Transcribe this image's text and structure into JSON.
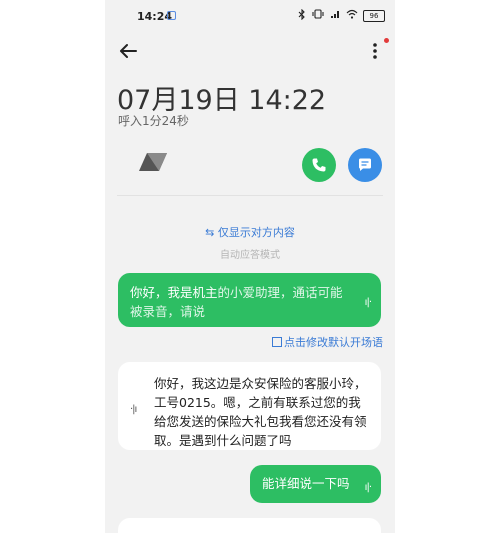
{
  "status_bar": {
    "time": "14:24",
    "battery": "96",
    "icons": [
      "bluetooth-icon",
      "vibrate-icon",
      "signal-icon",
      "wifi-icon",
      "battery-icon"
    ]
  },
  "header": {
    "title": "07月19日 14:22",
    "subtitle": "呼入1分24秒"
  },
  "links": {
    "show_other_party": "仅显示对方内容",
    "auto_answer_mode": "自动应答模式",
    "edit_greeting": "点击修改默认开场语"
  },
  "messages": [
    {
      "side": "right",
      "text_a": "你好，我是机主",
      "text_b": "的小爱助理，通话可能被录音，请说"
    },
    {
      "side": "left",
      "text": "你好，我这边是众安保险的客服小玲，工号0215。嗯，之前有联系过您的我给您发送的保险大礼包我看您还没有领取。是遇到什么问题了吗"
    },
    {
      "side": "right",
      "text": "能详细说一下吗"
    }
  ],
  "colors": {
    "green": "#2dbe63",
    "blue": "#3a8ee6",
    "link": "#3a7bd5",
    "background": "#f2f2f2"
  }
}
